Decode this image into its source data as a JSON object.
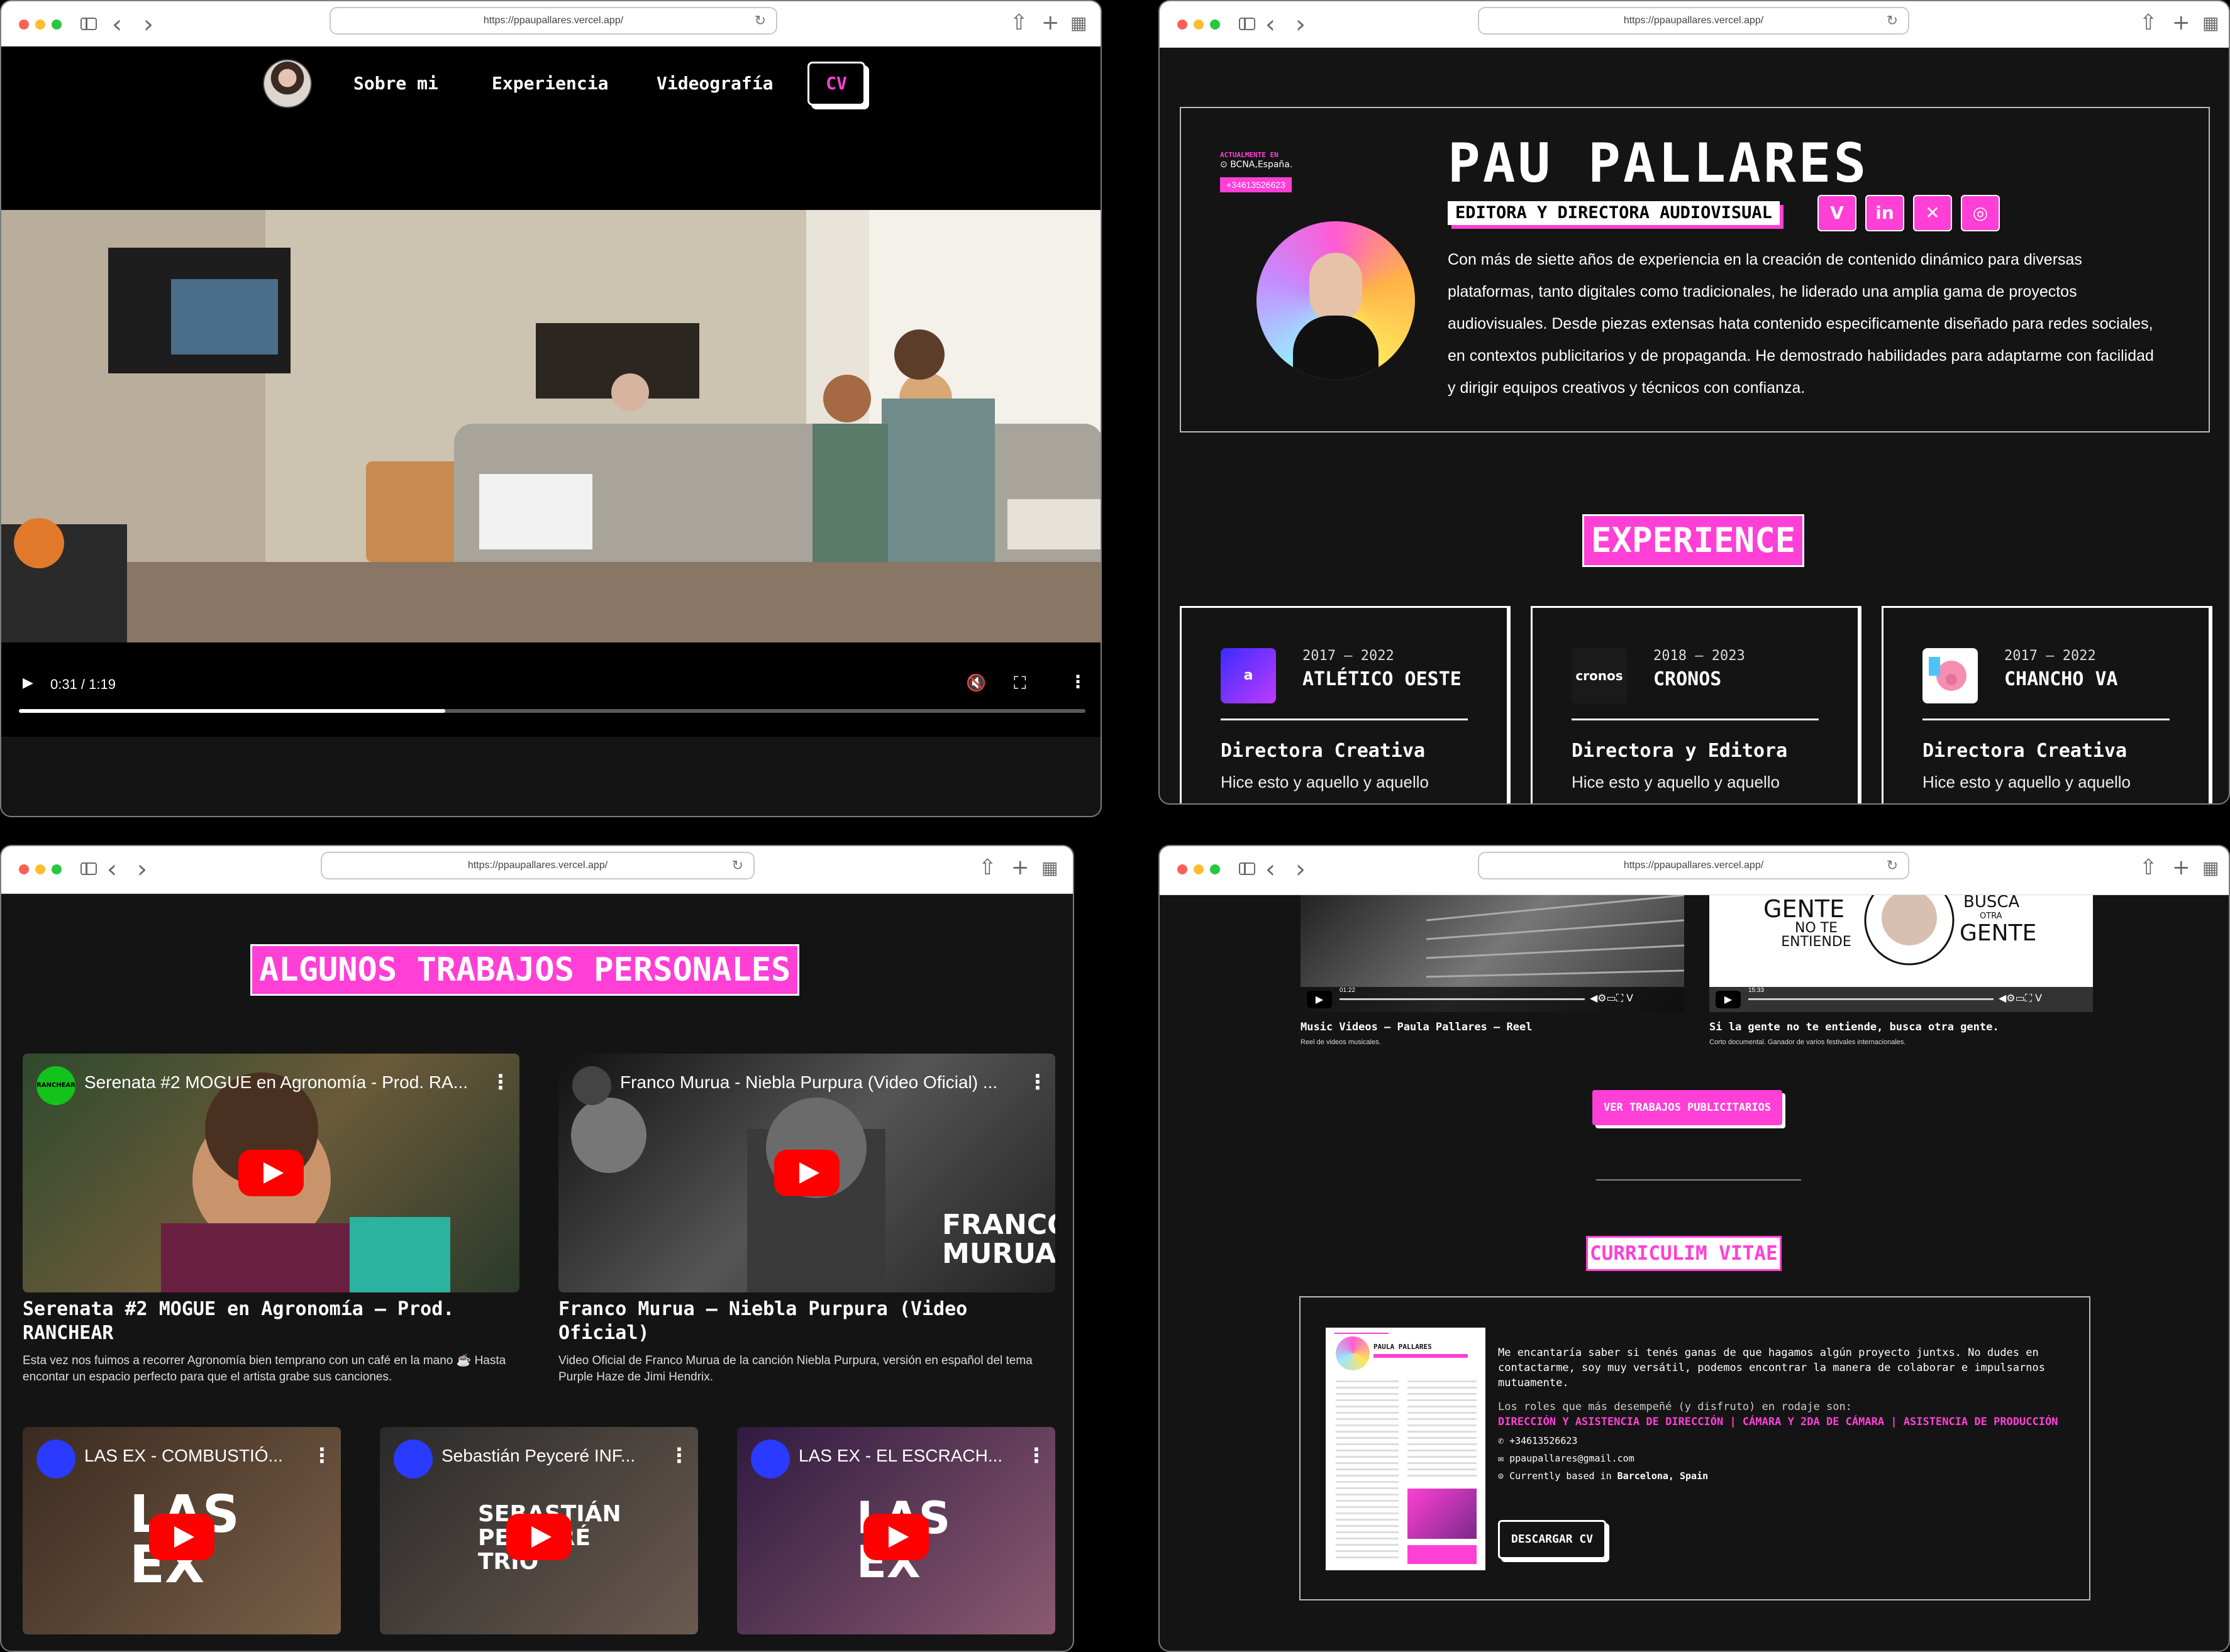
{
  "browser": {
    "url": "https://ppaupallares.vercel.app/"
  },
  "site_nav": {
    "links": [
      "Sobre mi",
      "Experiencia",
      "Videografía"
    ],
    "cv_label": "CV"
  },
  "video_player": {
    "time": "0:31 / 1:19",
    "progress": 0.4
  },
  "profile": {
    "tag_small": "ACTUALMENTE EN",
    "location": "BCNA,España.",
    "phone": "+34613526623",
    "name": "PAU PALLARES",
    "role": "EDITORA Y DIRECTORA AUDIOVISUAL",
    "social": [
      "vimeo-icon",
      "linkedin-icon",
      "x-icon",
      "instagram-icon"
    ],
    "bio": "Con más de siette años de experiencia en la creación de contenido dinámico para diversas plataformas, tanto digitales como tradicionales, he liderado una amplia gama de proyectos audiovisuales. Desde piezas extensas hata contenido especificamente diseñado para redes sociales, en contextos publicitarios y de propaganda. He demostrado habilidades para adaptarme con facilidad y dirigir equipos creativos y técnicos con confianza."
  },
  "experience": {
    "heading": "EXPERIENCE",
    "cards": [
      {
        "years": "2017 – 2022",
        "company": "ATLÉTICO OESTE",
        "job": "Directora Creativa",
        "desc": "Hice esto y aquello y aquello",
        "logo_text": "a"
      },
      {
        "years": "2018 – 2023",
        "company": "CRONOS",
        "job": "Directora y Editora",
        "desc": "Hice esto y aquello y aquello",
        "logo_text": "cronos"
      },
      {
        "years": "2017 – 2022",
        "company": "CHANCHO VA",
        "job": "Directora Creativa",
        "desc": "Hice esto y aquello y aquello",
        "logo_text": ""
      }
    ]
  },
  "personal": {
    "heading": "ALGUNOS TRABAJOS PERSONALES",
    "featured": [
      {
        "embed_title": "Serenata #2 MOGUE en Agronomía - Prod. RA...",
        "channel": "RANCHEAR",
        "title": "Serenata #2 MOGUE en Agronomía – Prod. RANCHEAR",
        "desc": "Esta vez nos fuimos a recorrer Agronomía bien temprano con un café en la mano ☕ Hasta encontar un espacio perfecto para que el artista grabe sus canciones."
      },
      {
        "embed_title": "Franco Murua - Niebla Purpura (Video Oficial) ...",
        "title": "Franco Murua – Niebla Purpura (Video Oficial)",
        "desc": "Video Oficial de Franco Murua de la canción Niebla Purpura, versión en español del tema Purple Haze de Jimi Hendrix.",
        "overlay": "FRANCO MURUA"
      }
    ],
    "small": [
      {
        "embed_title": "LAS EX - COMBUSTIÓ...",
        "overlay": "LAS EX"
      },
      {
        "embed_title": "Sebastián Peyceré INF...",
        "overlay": "SEBASTIÁN PEYCERÉ TRIO"
      },
      {
        "embed_title": "LAS EX - EL ESCRACH...",
        "overlay": "LAS EX"
      }
    ]
  },
  "works": {
    "items": [
      {
        "title": "Music Videos – Paula Pallares – Reel",
        "sub": "Reel de videos musicales.",
        "time": "01:22"
      },
      {
        "title": "Si la gente no te entiende, busca otra gente.",
        "sub": "Corto documental. Ganador de varios festivales internacionales.",
        "time": "15:33",
        "thumb_left": "GENTE",
        "thumb_left2": "NO TE ENTIENDE",
        "thumb_right": "BUSCA",
        "thumb_right2": "OTRA",
        "thumb_right3": "GENTE"
      }
    ],
    "button": "VER TRABAJOS PUBLICITARIOS"
  },
  "cv": {
    "heading": "CURRICULIM VITAE",
    "intro": "Me encantaría saber si tenés ganas de que hagamos algún proyecto juntxs. No dudes en contactarme, soy muy versátil, podemos encontrar la manera de colaborar e impulsarnos mutuamente.",
    "roles_label": "Los roles que más desempeñé (y disfruto) en rodaje son:",
    "roles": "DIRECCIÓN Y ASISTENCIA DE DIRECCIÓN | CÁMARA Y 2DA DE CÁMARA | ASISTENCIA DE PRODUCCIÓN",
    "phone": "+34613526623",
    "email": "ppaupallares@gmail.com",
    "based_label": "Currently based in",
    "based": "Barcelona, Spain",
    "download": "DESCARGAR CV",
    "thumb_name": "PAULA PALLARES"
  },
  "colors": {
    "accent": "#ff3fd6",
    "bg": "#141414"
  }
}
